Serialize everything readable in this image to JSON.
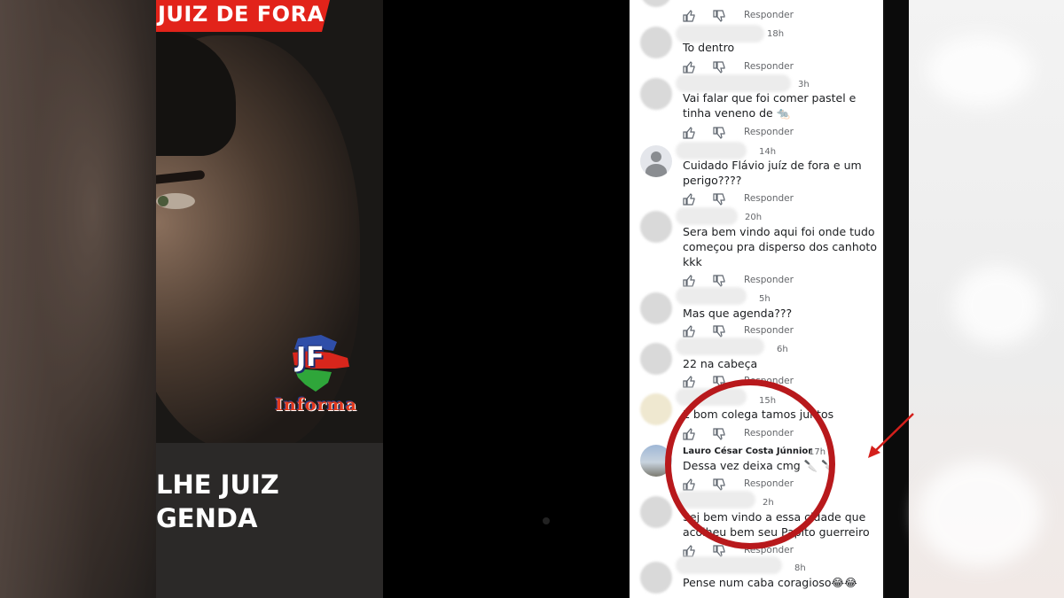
{
  "post": {
    "banner": "JUIZ DE FORA",
    "caption": "LHE JUIZ\nGENDA",
    "logo_abbr": "JF",
    "logo_word": "Informa"
  },
  "comments": [
    {
      "time": "",
      "text": "",
      "reply": "Responder"
    },
    {
      "time": "18h",
      "text": "To dentro",
      "reply": "Responder"
    },
    {
      "time": "3h",
      "text": "Vai falar que foi comer pastel e tinha veneno de 🐀",
      "reply": "Responder"
    },
    {
      "time": "14h",
      "text": "Cuidado Flávio juíz de fora e um perigo????",
      "reply": "Responder"
    },
    {
      "time": "20h",
      "text": "Sera bem vindo aqui foi onde tudo começou pra disperso dos canhoto kkk",
      "reply": "Responder"
    },
    {
      "time": "5h",
      "text": "Mas que agenda???",
      "reply": "Responder"
    },
    {
      "time": "6h",
      "text": "22 na cabeça",
      "reply": "Responder"
    },
    {
      "time": "15h",
      "text": "É bom colega tamos juntos",
      "reply": "Responder"
    },
    {
      "author": "Lauro César Costa Júnnior",
      "time": "17h",
      "text": "Dessa vez deixa cmg 🔪 🔪",
      "reply": "Responder"
    },
    {
      "time": "2h",
      "text": "Sej bem vindo a essa cidade que acolheu bem seu Papito guerreiro",
      "reply": "Responder"
    },
    {
      "time": "8h",
      "text": "Pense num caba coragioso😂😂",
      "reply": ""
    }
  ],
  "colors": {
    "highlight_ring": "#b8191c",
    "arrow": "#d4201c",
    "banner": "#e2231a"
  },
  "icons": [
    "thumbs-up-icon",
    "thumbs-down-icon",
    "default-avatar-icon"
  ]
}
